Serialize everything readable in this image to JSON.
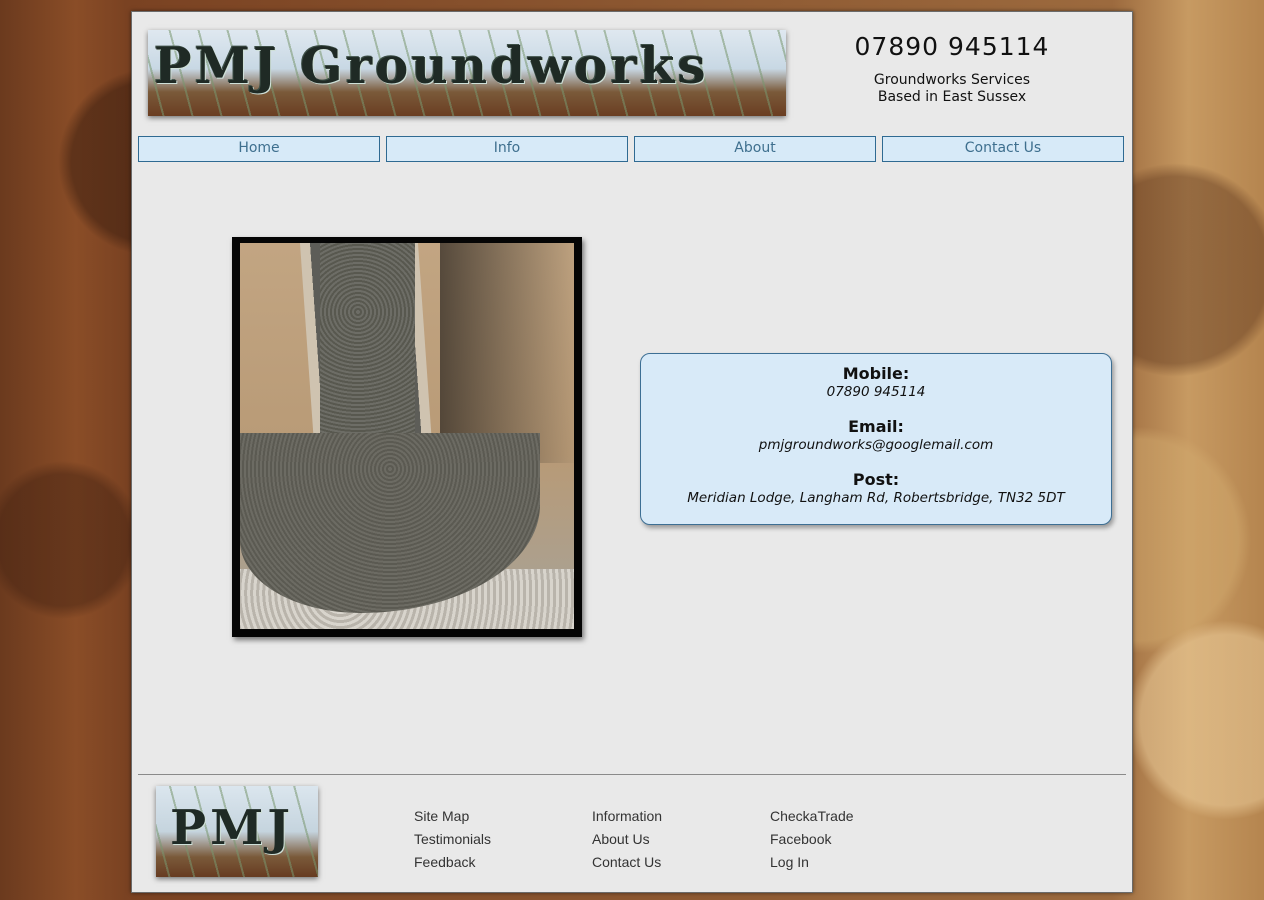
{
  "header": {
    "logo_text": "PMJ Groundworks",
    "phone": "07890 945114",
    "tagline_line1": "Groundworks Services",
    "tagline_line2": "Based in East Sussex"
  },
  "nav": {
    "items": [
      {
        "label": "Home"
      },
      {
        "label": "Info"
      },
      {
        "label": "About"
      },
      {
        "label": "Contact Us"
      }
    ]
  },
  "contact": {
    "mobile_label": "Mobile:",
    "mobile_value": "07890 945114",
    "email_label": "Email:",
    "email_value": "pmjgroundworks@googlemail.com",
    "post_label": "Post:",
    "post_value": "Meridian Lodge, Langham Rd, Robertsbridge, TN32 5DT"
  },
  "footer": {
    "logo_text": "PMJ",
    "col1": [
      "Site Map",
      "Testimonials",
      "Feedback"
    ],
    "col2": [
      "Information",
      "About Us",
      "Contact Us"
    ],
    "col3": [
      "CheckaTrade",
      "Facebook",
      "Log In"
    ]
  },
  "colors": {
    "nav_bg": "#d7eaf8",
    "nav_border": "#2f6a92",
    "nav_text": "#3e6f8e",
    "page_bg": "#e9e9e9"
  }
}
